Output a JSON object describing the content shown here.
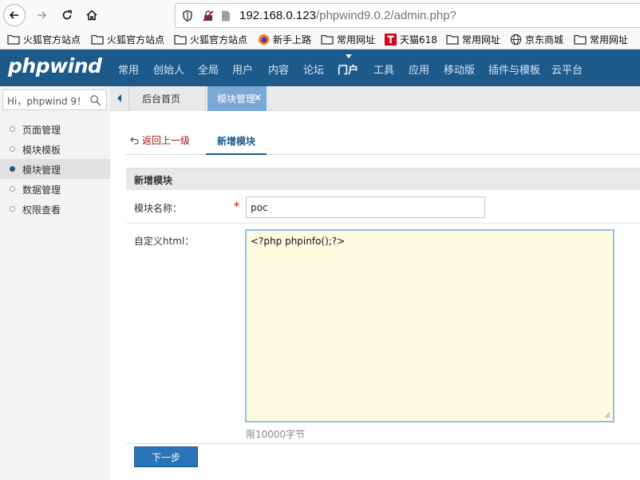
{
  "browser": {
    "url_host": "192.168.0.123",
    "url_path": "/phpwind9.0.2/admin.php?"
  },
  "bookmarks": [
    {
      "label": "火狐官方站点",
      "icon": "folder-icon"
    },
    {
      "label": "火狐官方站点",
      "icon": "folder-icon"
    },
    {
      "label": "火狐官方站点",
      "icon": "folder-icon"
    },
    {
      "label": "新手上路",
      "icon": "firefox-icon"
    },
    {
      "label": "常用网址",
      "icon": "folder-icon"
    },
    {
      "label": "天猫618",
      "icon": "tmall-icon"
    },
    {
      "label": "常用网址",
      "icon": "folder-icon"
    },
    {
      "label": "京东商城",
      "icon": "globe-icon"
    },
    {
      "label": "常用网址",
      "icon": "folder-icon"
    }
  ],
  "topnav": {
    "logo": "phpwind",
    "items": [
      "常用",
      "创始人",
      "全局",
      "用户",
      "内容",
      "论坛",
      "门户",
      "工具",
      "应用",
      "移动版",
      "插件与模板",
      "云平台"
    ],
    "active": "门户"
  },
  "sidebar": {
    "search_text": "Hi，phpwind 9！",
    "items": [
      "页面管理",
      "模块模板",
      "模块管理",
      "数据管理",
      "权限查看"
    ],
    "active": "模块管理"
  },
  "tabs": {
    "home": "后台首页",
    "current": "模块管理",
    "close": "×"
  },
  "subnav": {
    "back": "返回上一级",
    "current": "新增模块"
  },
  "form": {
    "section_title": "新增模块",
    "name_label": "模块名称：",
    "required_mark": "*",
    "name_value": "poc",
    "html_label": "自定义html：",
    "html_value": "<?php phpinfo();?>",
    "hint": "限10000字节",
    "next_button": "下一步"
  },
  "colors": {
    "nav_bg": "#1d5a8c",
    "active_tab": "#7aa9d8",
    "textarea_bg": "#fffae0",
    "button_bg": "#2b74b8"
  }
}
